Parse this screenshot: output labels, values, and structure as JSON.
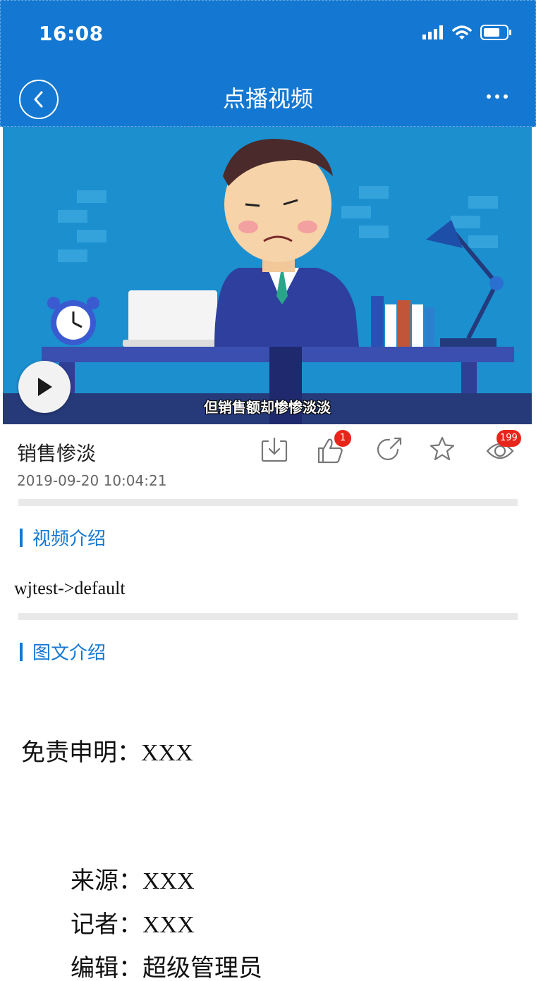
{
  "status_bar": {
    "time": "16:08"
  },
  "nav": {
    "title": "点播视频"
  },
  "video": {
    "subtitle": "但销售额却惨惨淡淡",
    "title": "销售惨淡",
    "date": "2019-09-20 10:04:21",
    "like_count": "1",
    "view_count": "199"
  },
  "sections": {
    "video_intro": {
      "heading": "视频介绍",
      "text": "wjtest->default"
    },
    "rich_intro": {
      "heading": "图文介绍",
      "disclaimer_label": "免责申明：",
      "disclaimer_value": "XXX",
      "source_label": "来源：",
      "source_value": "XXX",
      "reporter_label": "记者：",
      "reporter_value": "XXX",
      "editor_label": "编辑：",
      "editor_value": "超级管理员"
    }
  },
  "colors": {
    "brand": "#1478d2",
    "badge": "#e8251a",
    "video_bg": "#1c8fcf"
  },
  "icons": [
    "signal-icon",
    "wifi-icon",
    "battery-icon",
    "back-icon",
    "more-icon",
    "play-icon",
    "download-icon",
    "like-icon",
    "share-icon",
    "favorite-icon",
    "view-icon"
  ]
}
